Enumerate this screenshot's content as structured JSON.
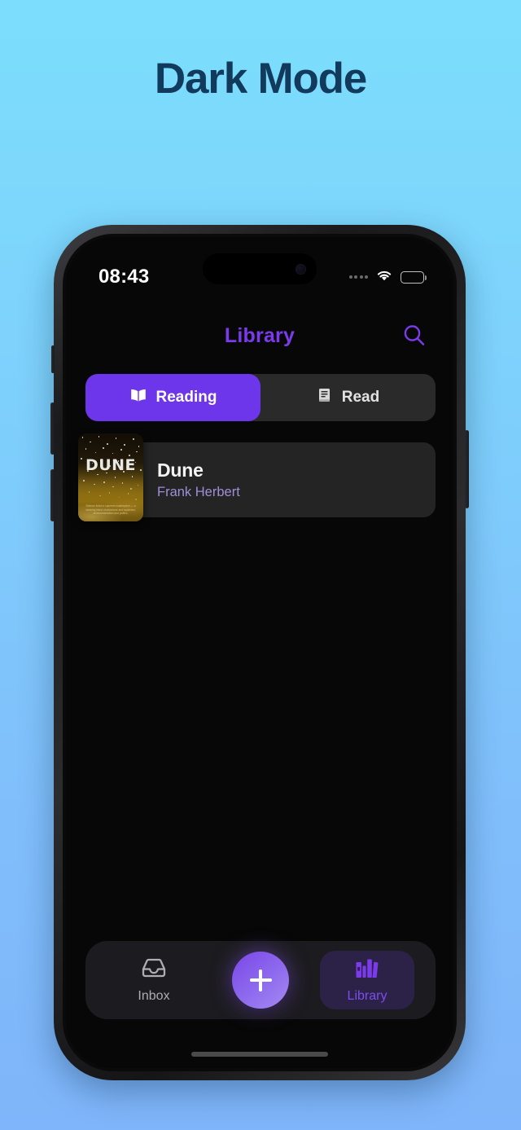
{
  "headline": "Dark Mode",
  "theme": {
    "accent_purple": "#6D36EB",
    "accent_purple_light": "#7C3AED",
    "author_purple": "#9F8FD8",
    "screen_bg": "#070707",
    "card_bg": "#242424",
    "segment_bg": "#2A2A2A",
    "nav_bg": "#1C1B1F",
    "nav_active_bg": "#2C2248",
    "page_bg_top": "#7CDEFC",
    "page_bg_bottom": "#7FB5FA"
  },
  "status_bar": {
    "time": "08:43",
    "cellular_icon": "cellular-dots-icon",
    "wifi_icon": "wifi-icon",
    "battery_icon": "battery-icon",
    "battery_level": 92
  },
  "header": {
    "title": "Library",
    "search_icon": "search-icon"
  },
  "segmented_control": {
    "selected": "Reading",
    "items": [
      {
        "label": "Reading",
        "icon": "open-book-icon",
        "active": true
      },
      {
        "label": "Read",
        "icon": "closed-book-icon",
        "active": false
      }
    ]
  },
  "library": {
    "books": [
      {
        "title": "Dune",
        "author": "Frank Herbert",
        "cover_title": "DUNE",
        "cover_blurb": "Science fiction's supreme masterpiece — a stunning blend of adventure and mysticism, environmentalism and politics."
      }
    ]
  },
  "bottom_nav": {
    "items": [
      {
        "label": "Inbox",
        "icon": "inbox-tray-icon",
        "active": false
      },
      {
        "label": "Library",
        "icon": "books-shelf-icon",
        "active": true
      }
    ],
    "fab": {
      "icon": "plus-icon",
      "label": "+"
    }
  }
}
